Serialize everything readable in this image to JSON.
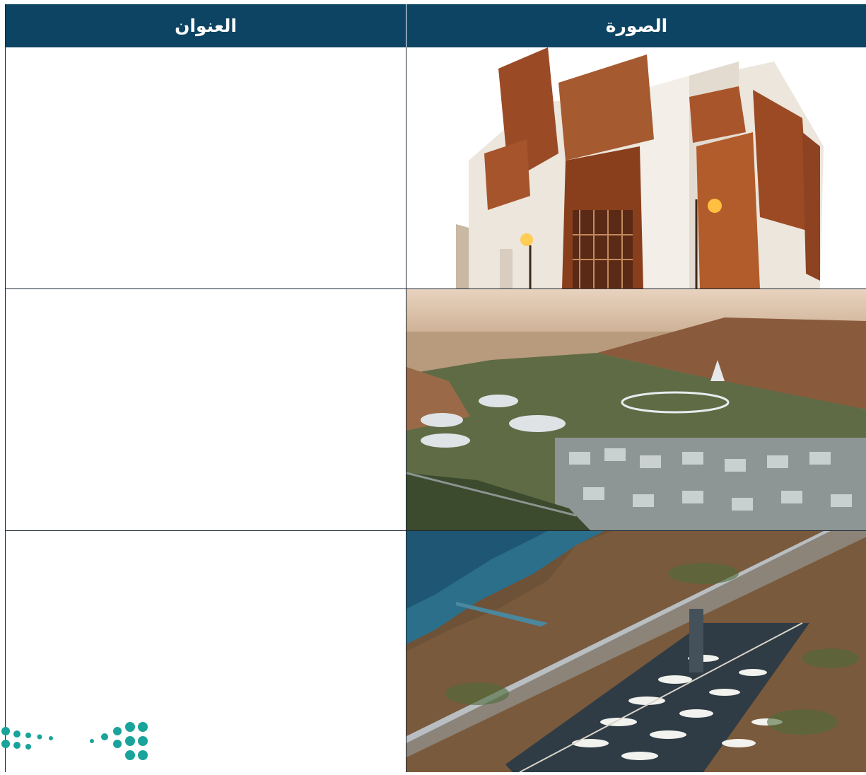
{
  "table": {
    "headers": {
      "title": "العنوان",
      "image": "الصورة"
    },
    "rows": [
      {
        "title": "",
        "image_icon": "historic-building-image"
      },
      {
        "title": "",
        "image_icon": "futuristic-city-image"
      },
      {
        "title": "",
        "image_icon": "marina-coast-image"
      }
    ]
  },
  "colors": {
    "header_bg": "#0d4463",
    "header_text": "#ffffff",
    "border": "#1b2733",
    "logo_teal": "#1aa39a"
  },
  "logo": {
    "icon": "ministry-logo-dots"
  }
}
